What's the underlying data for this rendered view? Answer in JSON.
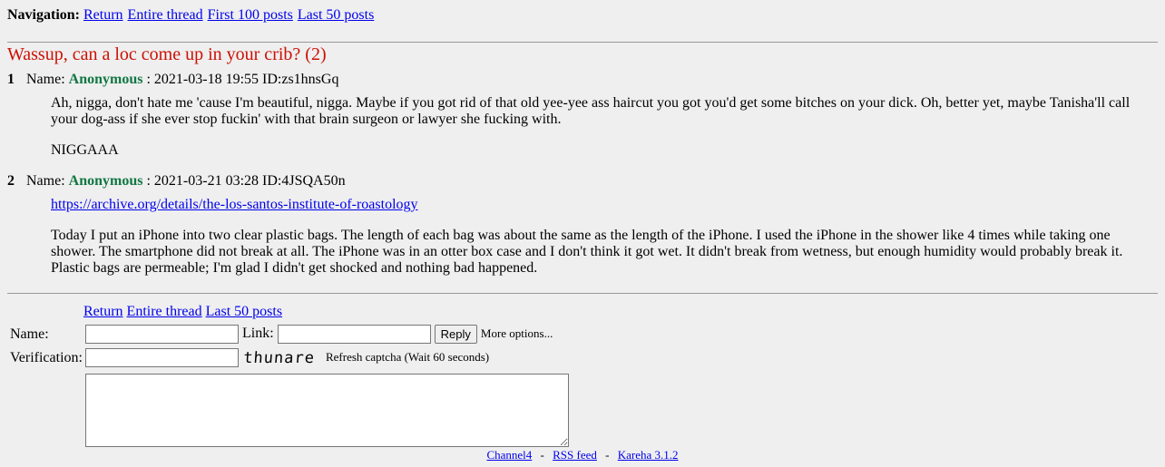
{
  "nav": {
    "label": "Navigation:",
    "links": [
      "Return",
      "Entire thread",
      "First 100 posts",
      "Last 50 posts"
    ]
  },
  "thread": {
    "title": "Wassup, can a loc come up in your crib? (2)"
  },
  "posts": [
    {
      "num": "1",
      "name_label": "Name:",
      "name": "Anonymous",
      "meta": ": 2021-03-18 19:55 ID:zs1hnsGq",
      "paragraphs": [
        "Ah, nigga, don't hate me 'cause I'm beautiful, nigga. Maybe if you got rid of that old yee-yee ass haircut you got you'd get some bitches on your dick. Oh, better yet, maybe Tanisha'll call your dog-ass if she ever stop fuckin' with that brain surgeon or lawyer she fucking with.",
        "NIGGAAA"
      ]
    },
    {
      "num": "2",
      "name_label": "Name:",
      "name": "Anonymous",
      "meta": ": 2021-03-21 03:28 ID:4JSQA50n",
      "link": "https://archive.org/details/the-los-santos-institute-of-roastology",
      "paragraphs": [
        "Today I put an iPhone into two clear plastic bags. The length of each bag was about the same as the length of the iPhone. I used the iPhone in the shower like 4 times while taking one shower. The smartphone did not break at all. The iPhone was in an otter box case and I don't think it got wet. It didn't break from wetness, but enough humidity would probably break it. Plastic bags are permeable; I'm glad I didn't get shocked and nothing bad happened."
      ]
    }
  ],
  "form": {
    "links": [
      "Return",
      "Entire thread",
      "Last 50 posts"
    ],
    "name_label": "Name:",
    "link_label": "Link:",
    "reply_button": "Reply",
    "more_options": "More options...",
    "verification_label": "Verification:",
    "captcha_text": "thunare",
    "refresh_captcha": "Refresh captcha (Wait 60 seconds)",
    "name_value": "",
    "link_value": "",
    "verification_value": "",
    "message_value": ""
  },
  "footer": {
    "links": [
      "Channel4",
      "RSS feed",
      "Kareha 3.1.2"
    ],
    "separator": "-"
  },
  "colors": {
    "background": "#efefef",
    "title": "#cc1105",
    "poster_name": "#117743",
    "link": "#0000ee"
  }
}
